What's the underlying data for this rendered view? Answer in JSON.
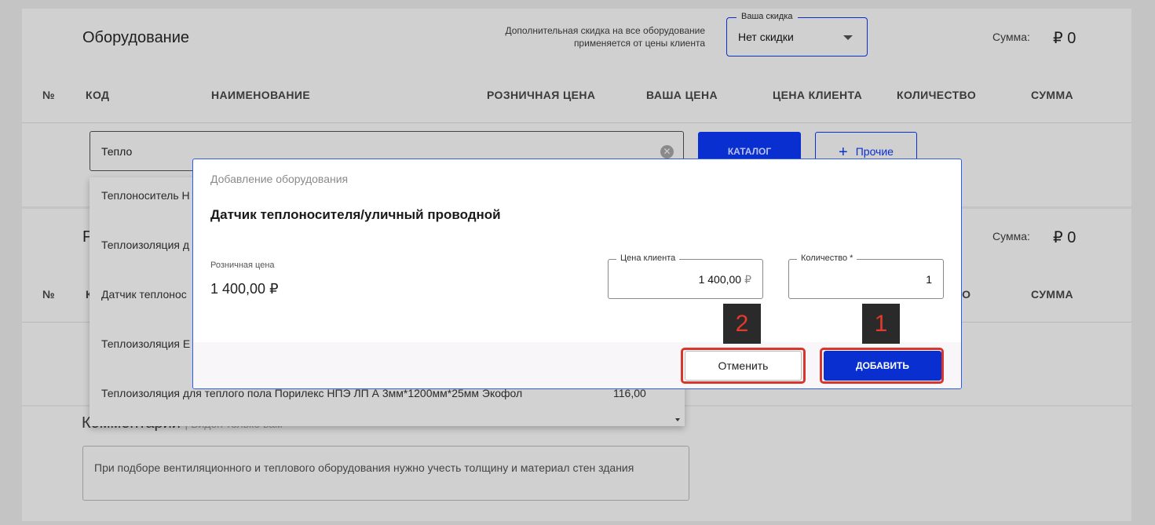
{
  "equipment": {
    "title": "Оборудование",
    "discount_note_line1": "Дополнительная скидка на все оборудование",
    "discount_note_line2": "применяется от цены клиента",
    "discount_label": "Ваша скидка",
    "discount_value": "Нет скидки",
    "sum_label": "Сумма:",
    "sum_value": "₽ 0",
    "columns": [
      "№",
      "КОД",
      "НАИМЕНОВАНИЕ",
      "РОЗНИЧНАЯ ЦЕНА",
      "ВАША ЦЕНА",
      "ЦЕНА КЛИЕНТА",
      "КОЛИЧЕСТВО",
      "СУММА"
    ],
    "search_value": "Тепло",
    "catalog_button": "КАТАЛОГ",
    "other_button": "Прочие"
  },
  "section2": {
    "title_partial": "Р",
    "sum_label": "Сумма:",
    "sum_value": "₽ 0",
    "col_number": "№",
    "col_code_partial": "К",
    "col_quantity_partial": "ВО",
    "col_sum": "СУММА"
  },
  "dropdown": {
    "items": [
      "Теплоноситель Н",
      "Теплоизоляция д",
      "Датчик теплонос",
      "Теплоизоляция Е",
      "Теплоизоляция для теплого пола Порилекс НПЭ ЛП А 3мм*1200мм*25мм Экофол"
    ],
    "last_item_price": "116,00"
  },
  "comment": {
    "title": "Комментарий",
    "hint": "Виден только вам",
    "text": "При подборе вентиляционного и теплового оборудования нужно учесть толщину и материал стен здания"
  },
  "modal": {
    "header": "Добавление оборудования",
    "title": "Датчик теплоносителя/уличный проводной",
    "retail_label": "Розничная цена",
    "retail_value": "1 400,00 ₽",
    "client_price_label": "Цена клиента",
    "client_price_value": "1 400,00",
    "client_price_currency": "₽",
    "quantity_label": "Количество *",
    "quantity_value": "1",
    "cancel_button": "Отменить",
    "add_button": "ДОБАВИТЬ"
  },
  "annotations": {
    "badge_add": "1",
    "badge_cancel": "2",
    "highlight_color": "#d8352b"
  },
  "colors": {
    "primary": "#0a2fd0",
    "overlay_bg": "#c4c4c4"
  }
}
